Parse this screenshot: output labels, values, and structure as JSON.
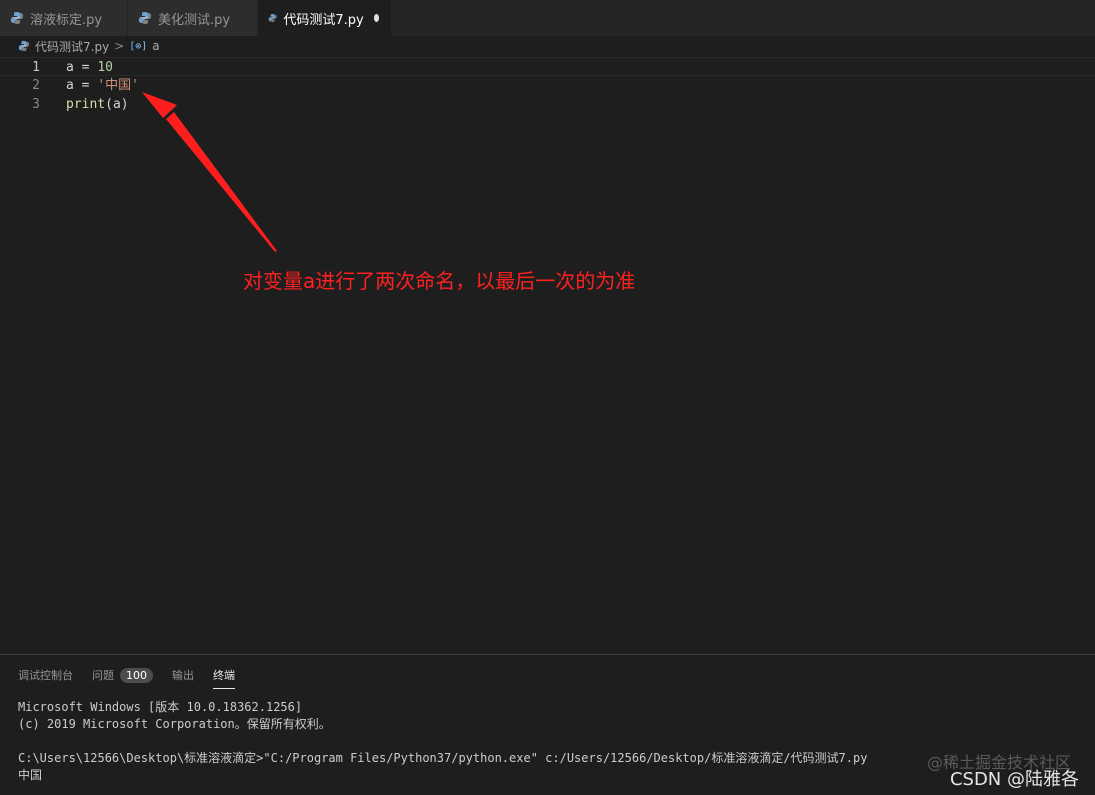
{
  "tabs": [
    {
      "label": "溶液标定.py",
      "active": false,
      "dirty": false
    },
    {
      "label": "美化测试.py",
      "active": false,
      "dirty": false
    },
    {
      "label": "代码测试7.py",
      "active": true,
      "dirty": true
    }
  ],
  "breadcrumb": {
    "file": "代码测试7.py",
    "separator": ">",
    "symbol_icon": "[⊗]",
    "symbol": "a"
  },
  "editor": {
    "line_numbers": [
      "1",
      "2",
      "3"
    ],
    "line1": {
      "var": "a",
      "op": " = ",
      "value": "10"
    },
    "line2": {
      "var": "a",
      "op": " = ",
      "value": "'中国'"
    },
    "line3": {
      "fn": "print",
      "args": "(a)"
    }
  },
  "annotation": {
    "text": "对变量a进行了两次命名，以最后一次的为准",
    "color": "#ff2020"
  },
  "panel": {
    "tabs": [
      {
        "label": "调试控制台"
      },
      {
        "label": "问题",
        "badge": "100"
      },
      {
        "label": "输出"
      },
      {
        "label": "终端"
      }
    ],
    "terminal_lines": [
      "Microsoft Windows [版本 10.0.18362.1256]",
      "(c) 2019 Microsoft Corporation。保留所有权利。",
      "",
      "C:\\Users\\12566\\Desktop\\标准溶液滴定>\"C:/Program Files/Python37/python.exe\" c:/Users/12566/Desktop/标准溶液滴定/代码测试7.py",
      "中国"
    ]
  },
  "watermarks": {
    "line1": "@稀土掘金技术社区",
    "line2": "CSDN @陆雅各"
  },
  "colors": {
    "background": "#1e1e1e",
    "tab_inactive": "#2d2d2d",
    "number": "#b5cea8",
    "string": "#ce9178",
    "function": "#dcdcaa"
  }
}
